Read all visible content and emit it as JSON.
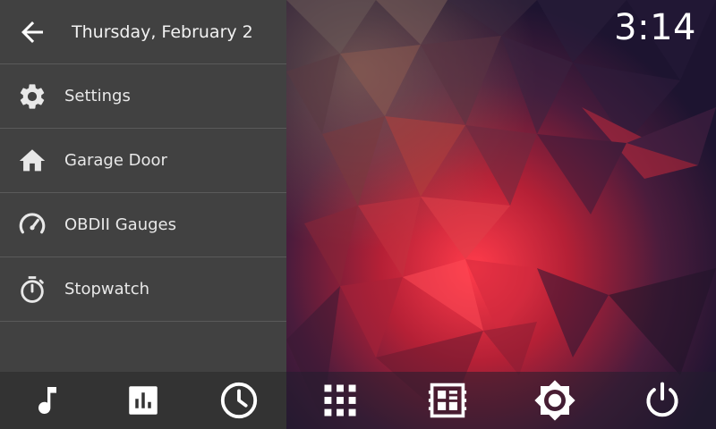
{
  "clock": {
    "time": "3:14"
  },
  "drawer": {
    "date": "Thursday, February  2",
    "items": [
      {
        "label": "Settings",
        "icon": "gear-icon"
      },
      {
        "label": "Garage Door",
        "icon": "home-icon"
      },
      {
        "label": "OBDII Gauges",
        "icon": "speedometer-icon"
      },
      {
        "label": "Stopwatch",
        "icon": "stopwatch-icon"
      }
    ]
  },
  "bottom_bar": {
    "buttons": [
      {
        "icon": "music-note-icon"
      },
      {
        "icon": "equalizer-icon"
      },
      {
        "icon": "clock-icon"
      },
      {
        "icon": "apps-grid-icon"
      },
      {
        "icon": "dashboard-icon"
      },
      {
        "icon": "brightness-icon"
      },
      {
        "icon": "power-icon"
      }
    ]
  },
  "colors": {
    "drawer_bg": "#414141",
    "bottom_left_bg": "#333333",
    "accent_red": "#e0283a",
    "wallpaper_dark": "#1d1430"
  }
}
